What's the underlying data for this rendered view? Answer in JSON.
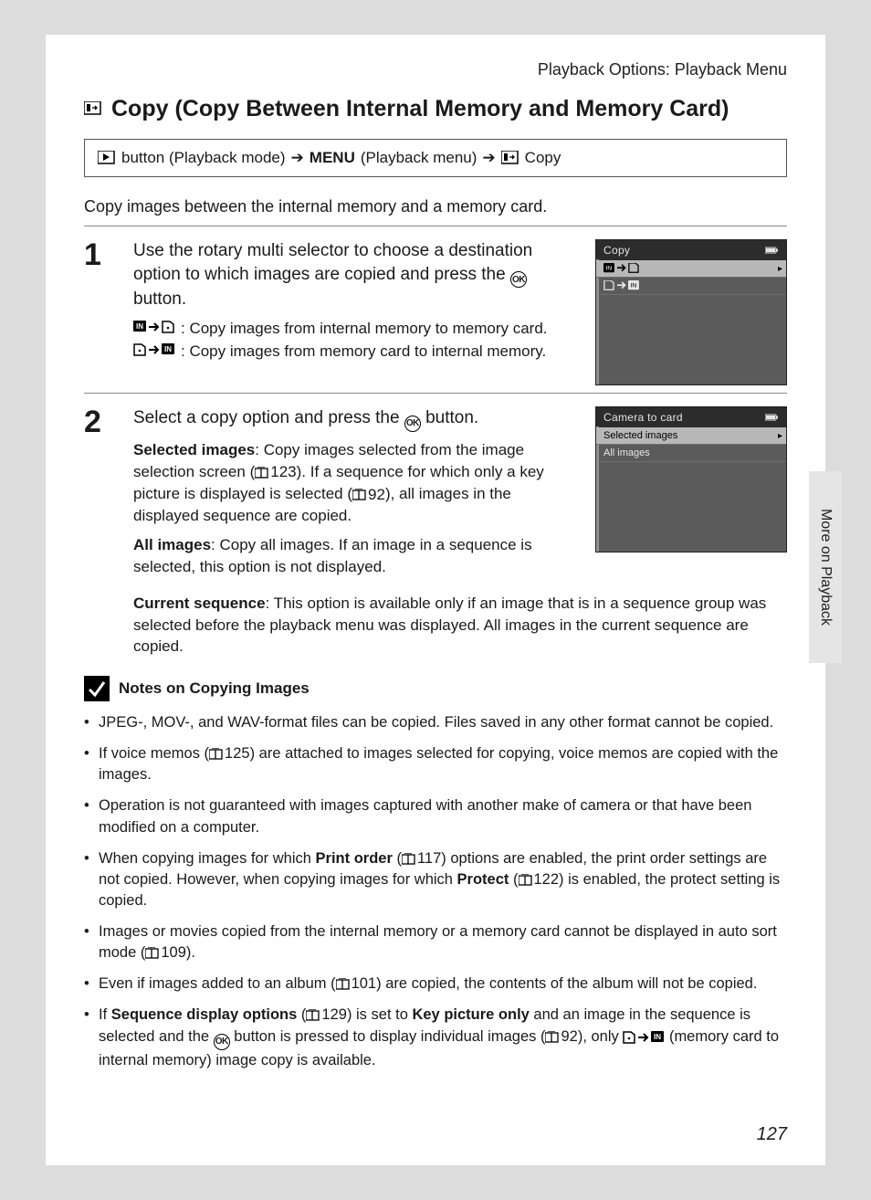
{
  "header": {
    "breadcrumb": "Playback Options: Playback Menu"
  },
  "title": "Copy (Copy Between Internal Memory and Memory Card)",
  "nav": {
    "playback_mode": "button (Playback mode)",
    "menu_word": "MENU",
    "playback_menu": "(Playback menu)",
    "copy_word": "Copy"
  },
  "intro": "Copy images between the internal memory and a memory card.",
  "step1": {
    "num": "1",
    "title_a": "Use the rotary multi selector to choose a destination option to which images are copied and press the ",
    "title_b": " button.",
    "opt1": ": Copy images from internal memory to memory card.",
    "opt2": ": Copy images from memory card to internal memory.",
    "screen_title": "Copy"
  },
  "step2": {
    "num": "2",
    "title_a": "Select a copy option and press the ",
    "title_b": " button.",
    "sel_strong": "Selected images",
    "sel_a": ": Copy images selected from the image selection screen (",
    "sel_ref1": "123",
    "sel_b": "). If a sequence for which only a key picture is displayed is selected (",
    "sel_ref2": "92",
    "sel_c": "), all images in the displayed sequence are copied.",
    "all_strong": "All images",
    "all_text": ": Copy all images. If an image in a sequence is selected, this option is not displayed.",
    "cur_strong": "Current sequence",
    "cur_text": ": This option is available only if an image that is in a sequence group was selected before the playback menu was displayed. All images in the current sequence are copied.",
    "screen_title": "Camera to card",
    "screen_opt1": "Selected images",
    "screen_opt2": "All images"
  },
  "notes": {
    "heading": "Notes on Copying Images",
    "n1": "JPEG-, MOV-, and WAV-format files can be copied. Files saved in any other format cannot be copied.",
    "n2_a": "If voice memos (",
    "n2_ref": "125",
    "n2_b": ") are attached to images selected for copying, voice memos are copied with the images.",
    "n3": "Operation is not guaranteed with images captured with another make of camera or that have been modified on a computer.",
    "n4_a": "When copying images for which ",
    "n4_strong1": "Print order",
    "n4_b": " (",
    "n4_ref1": "117",
    "n4_c": ") options are enabled, the print order settings are not copied. However, when copying images for which ",
    "n4_strong2": "Protect",
    "n4_d": " (",
    "n4_ref2": "122",
    "n4_e": ") is enabled, the protect setting is copied.",
    "n5_a": "Images or movies copied from the internal memory or a memory card cannot be displayed in auto sort mode (",
    "n5_ref": "109",
    "n5_b": ").",
    "n6_a": "Even if images added to an album (",
    "n6_ref": "101",
    "n6_b": ") are copied, the contents of the album will not be copied.",
    "n7_a": "If ",
    "n7_strong1": "Sequence display options",
    "n7_b": " (",
    "n7_ref1": "129",
    "n7_c": ") is set to ",
    "n7_strong2": "Key picture only",
    "n7_d": " and an image in the sequence is selected and the ",
    "n7_e": " button is pressed to display individual images (",
    "n7_ref2": "92",
    "n7_f": "), only ",
    "n7_g": " (memory card to internal memory) image copy is available."
  },
  "side_tab": "More on Playback",
  "page_number": "127",
  "ok_label": "OK"
}
